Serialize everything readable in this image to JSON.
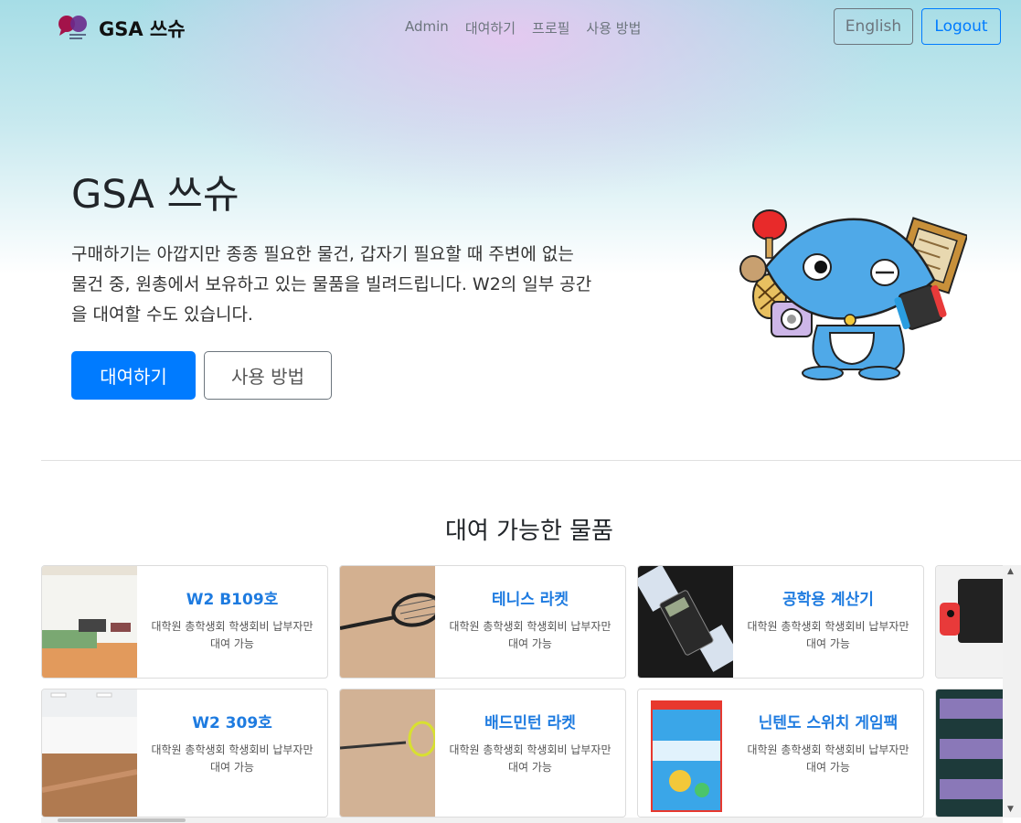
{
  "nav": {
    "brand": "GSA 쓰슈",
    "links": [
      "Admin",
      "대여하기",
      "프로필",
      "사용 방법"
    ],
    "language_button": "English",
    "logout_button": "Logout"
  },
  "hero": {
    "title": "GSA 쓰슈",
    "description": "구매하기는 아깝지만 종종 필요한 물건, 갑자기 필요할 때 주변에 없는 물건 중, 원총에서 보유하고 있는 물품을 빌려드립니다. W2의 일부 공간을 대여할 수도 있습니다.",
    "primary_button": "대여하기",
    "secondary_button": "사용 방법"
  },
  "items_section": {
    "title": "대여 가능한 물품",
    "cards": [
      {
        "title": "W2 B109호",
        "desc": "대학원 총학생회 학생회비 납부자만 대여 가능",
        "image": "room-photo"
      },
      {
        "title": "테니스 라켓",
        "desc": "대학원 총학생회 학생회비 납부자만 대여 가능",
        "image": "tennis-racket-photo"
      },
      {
        "title": "공학용 계산기",
        "desc": "대학원 총학생회 학생회비 납부자만 대여 가능",
        "image": "calculator-photo"
      },
      {
        "title": "",
        "desc": "",
        "image": "nintendo-switch-photo"
      },
      {
        "title": "W2 309호",
        "desc": "대학원 총학생회 학생회비 납부자만 대여 가능",
        "image": "hall-photo"
      },
      {
        "title": "배드민턴 라켓",
        "desc": "대학원 총학생회 학생회비 납부자만 대여 가능",
        "image": "badminton-racket-photo"
      },
      {
        "title": "닌텐도 스위치 게임팩",
        "desc": "대학원 총학생회 학생회비 납부자만 대여 가능",
        "image": "switch-sports-photo"
      },
      {
        "title": "",
        "desc": "",
        "image": "mats-photo"
      }
    ]
  },
  "colors": {
    "accent": "#007bff",
    "card_title": "#1e7be0"
  }
}
